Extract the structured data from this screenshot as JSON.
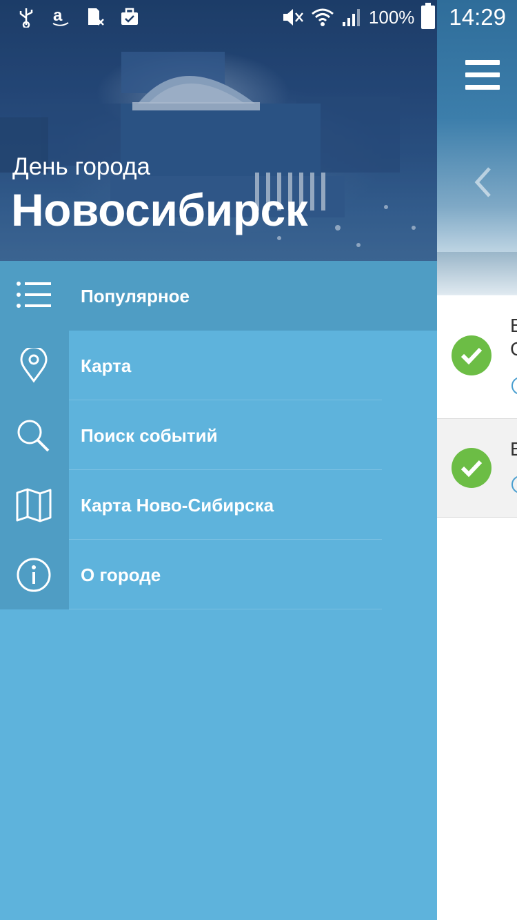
{
  "status_bar": {
    "battery": "100%",
    "time": "14:29",
    "icons": [
      "usb-icon",
      "amazon-icon",
      "sim-icon",
      "briefcase-icon",
      "mute-icon",
      "wifi-icon",
      "signal-icon",
      "battery-icon"
    ]
  },
  "drawer": {
    "subtitle": "День города",
    "title": "Новосибирск",
    "items": [
      {
        "label": "Популярное",
        "icon": "list-icon",
        "active": true
      },
      {
        "label": "Карта",
        "icon": "location-pin-icon",
        "active": false
      },
      {
        "label": "Поиск событий",
        "icon": "search-icon",
        "active": false
      },
      {
        "label": "Карта Ново-Сибирска",
        "icon": "map-icon",
        "active": false
      },
      {
        "label": "О городе",
        "icon": "info-icon",
        "active": false
      }
    ]
  },
  "background_app": {
    "list": [
      {
        "line1": "В",
        "line2": "С"
      },
      {
        "line1": "В"
      }
    ]
  },
  "colors": {
    "drawer_bg": "#5eb3dc",
    "drawer_icon_cell": "#4f9dc4",
    "check_green": "#6cbd45"
  }
}
